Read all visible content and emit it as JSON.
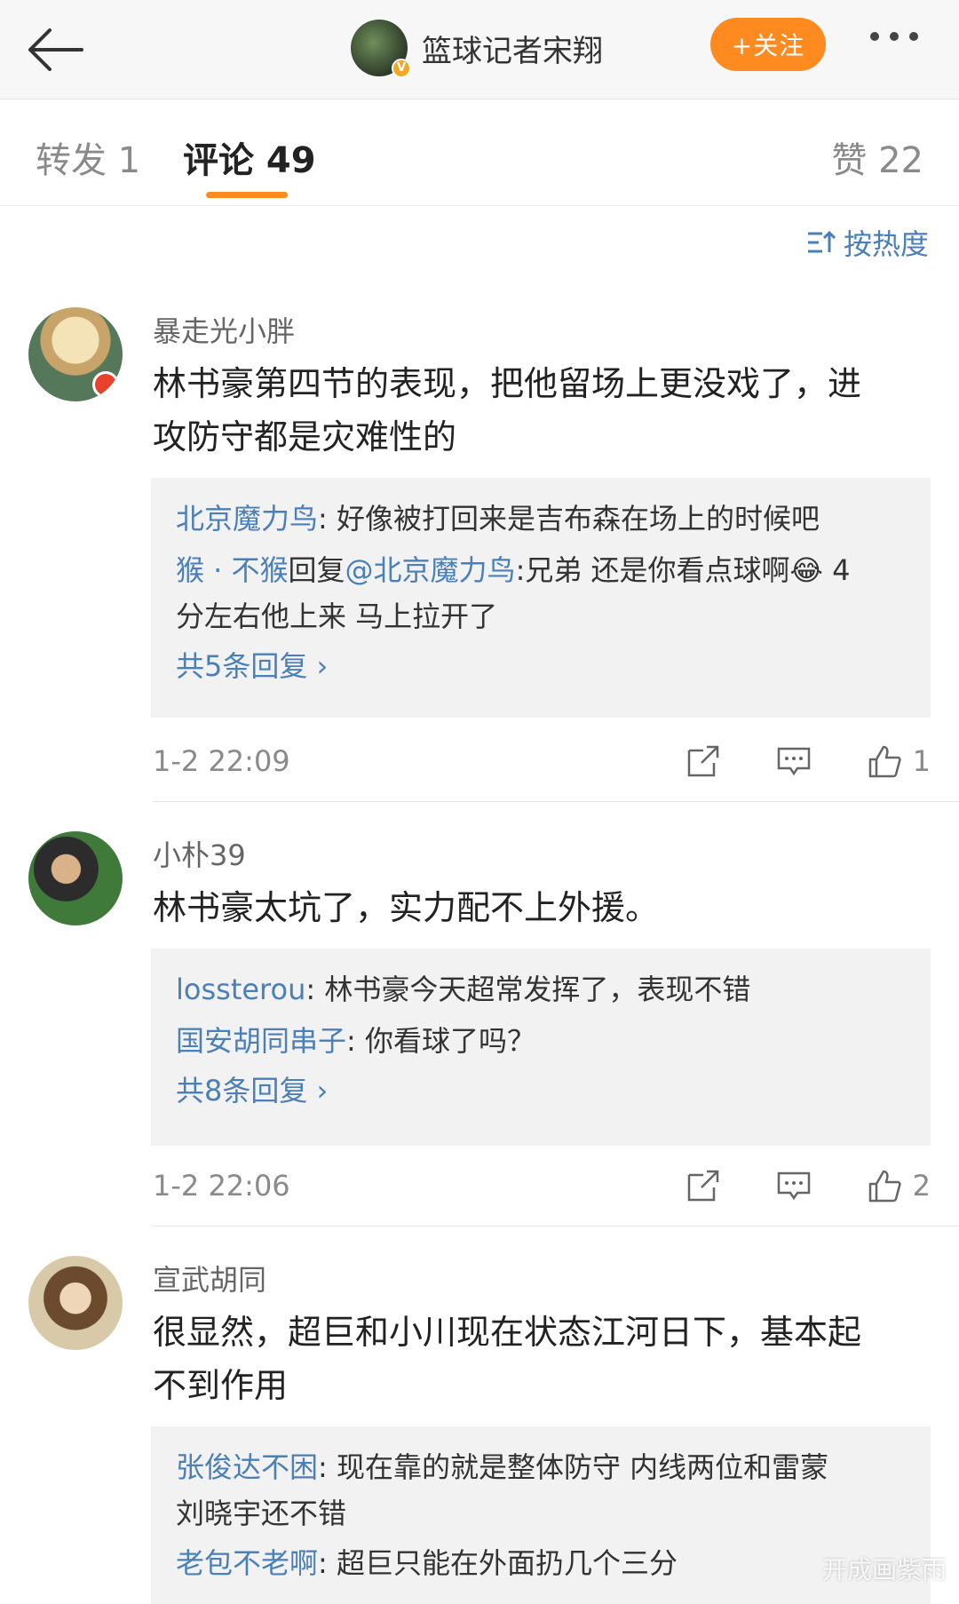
{
  "header": {
    "account_name": "篮球记者宋翔",
    "follow_label": "+关注"
  },
  "tabs": {
    "forward": "转发 1",
    "comment": "评论 49",
    "like": "赞 22"
  },
  "sort_label": "按热度",
  "colors": {
    "accent": "#ff8a1f",
    "link": "#4a7fb8"
  },
  "comments": [
    {
      "username": "暴走光小胖",
      "text_line1": "林书豪第四节的表现，把他留场上更没戏了，进",
      "text_line2": "攻防守都是灾难性的",
      "replies": [
        {
          "name": "北京魔力鸟",
          "text": ": 好像被打回来是吉布森在场上的时候吧"
        },
        {
          "name": "猴 · 不猴",
          "reply_word": "回复",
          "at": "@北京魔力鸟",
          "text": ":兄弟 还是你看点球啊😂 4",
          "text2": "分左右他上来 马上拉开了"
        }
      ],
      "more_replies": "共5条回复",
      "time": "1-2 22:09",
      "likes": "1"
    },
    {
      "username": "小朴39",
      "text_line1": "林书豪太坑了，实力配不上外援。",
      "replies": [
        {
          "name": "lossterou",
          "text": ": 林书豪今天超常发挥了，表现不错"
        },
        {
          "name": "国安胡同串子",
          "text": ": 你看球了吗？"
        }
      ],
      "more_replies": "共8条回复",
      "time": "1-2 22:06",
      "likes": "2"
    },
    {
      "username": "宣武胡同",
      "text_line1": "很显然，超巨和小川现在状态江河日下，基本起",
      "text_line2": "不到作用",
      "replies": [
        {
          "name": "张俊达不困",
          "text": ": 现在靠的就是整体防守 内线两位和雷蒙",
          "text2": "刘晓宇还不错"
        },
        {
          "name": "老包不老啊",
          "text": ": 超巨只能在外面扔几个三分"
        }
      ]
    }
  ],
  "watermark": "开成画紫雨"
}
